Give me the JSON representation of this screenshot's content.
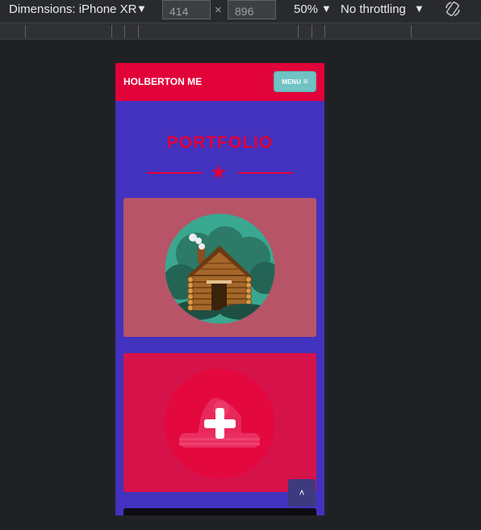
{
  "devtools": {
    "dimensions_label": "Dimensions: iPhone XR",
    "width_value": "414",
    "height_value": "896",
    "times_symbol": "×",
    "zoom": "50%",
    "throttling": "No throttling",
    "dropdown_arrow": "▼"
  },
  "site": {
    "brand": "HOLBERTON ME",
    "menu_label": "MENU",
    "menu_icon": "≡",
    "section_title": "PORTFOLIO",
    "divider_icon": "★",
    "cards": [
      {
        "icon": "log-cabin-illustration",
        "bg": "#b85468"
      },
      {
        "icon": "plus-overlay-icon",
        "bg": "#d6124a"
      }
    ],
    "back_to_top_icon": "˄",
    "colors": {
      "primary": "#e2023a",
      "background": "#4232be",
      "accent": "#70c2c4"
    }
  }
}
